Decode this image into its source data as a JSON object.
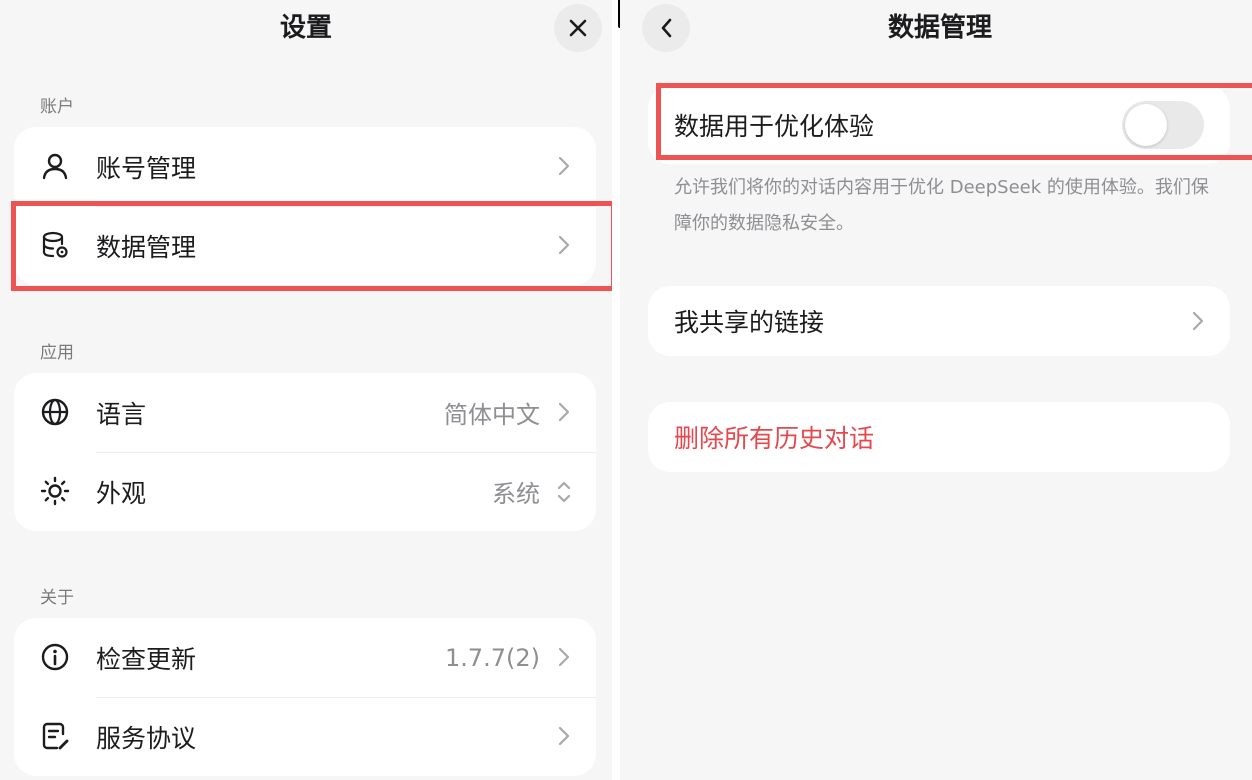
{
  "settings": {
    "title": "设置",
    "sections": {
      "account": {
        "label": "账户",
        "items": [
          {
            "label": "账号管理",
            "icon": "user-icon"
          },
          {
            "label": "数据管理",
            "icon": "database-settings-icon"
          }
        ]
      },
      "app": {
        "label": "应用",
        "items": [
          {
            "label": "语言",
            "value": "简体中文",
            "icon": "globe-icon"
          },
          {
            "label": "外观",
            "value": "系统",
            "icon": "sun-icon"
          }
        ]
      },
      "about": {
        "label": "关于",
        "items": [
          {
            "label": "检查更新",
            "value": "1.7.7(2)",
            "icon": "info-icon"
          },
          {
            "label": "服务协议",
            "icon": "document-edit-icon"
          }
        ]
      }
    }
  },
  "data_management": {
    "title": "数据管理",
    "optimize": {
      "label": "数据用于优化体验",
      "enabled": false,
      "description": "允许我们将你的对话内容用于优化 DeepSeek 的使用体验。我们保障你的数据隐私安全。"
    },
    "shared_links_label": "我共享的链接",
    "delete_all_label": "删除所有历史对话"
  },
  "colors": {
    "highlight": "#ef5454",
    "danger": "#e5484d",
    "background": "#f6f6f6",
    "card": "#ffffff"
  }
}
